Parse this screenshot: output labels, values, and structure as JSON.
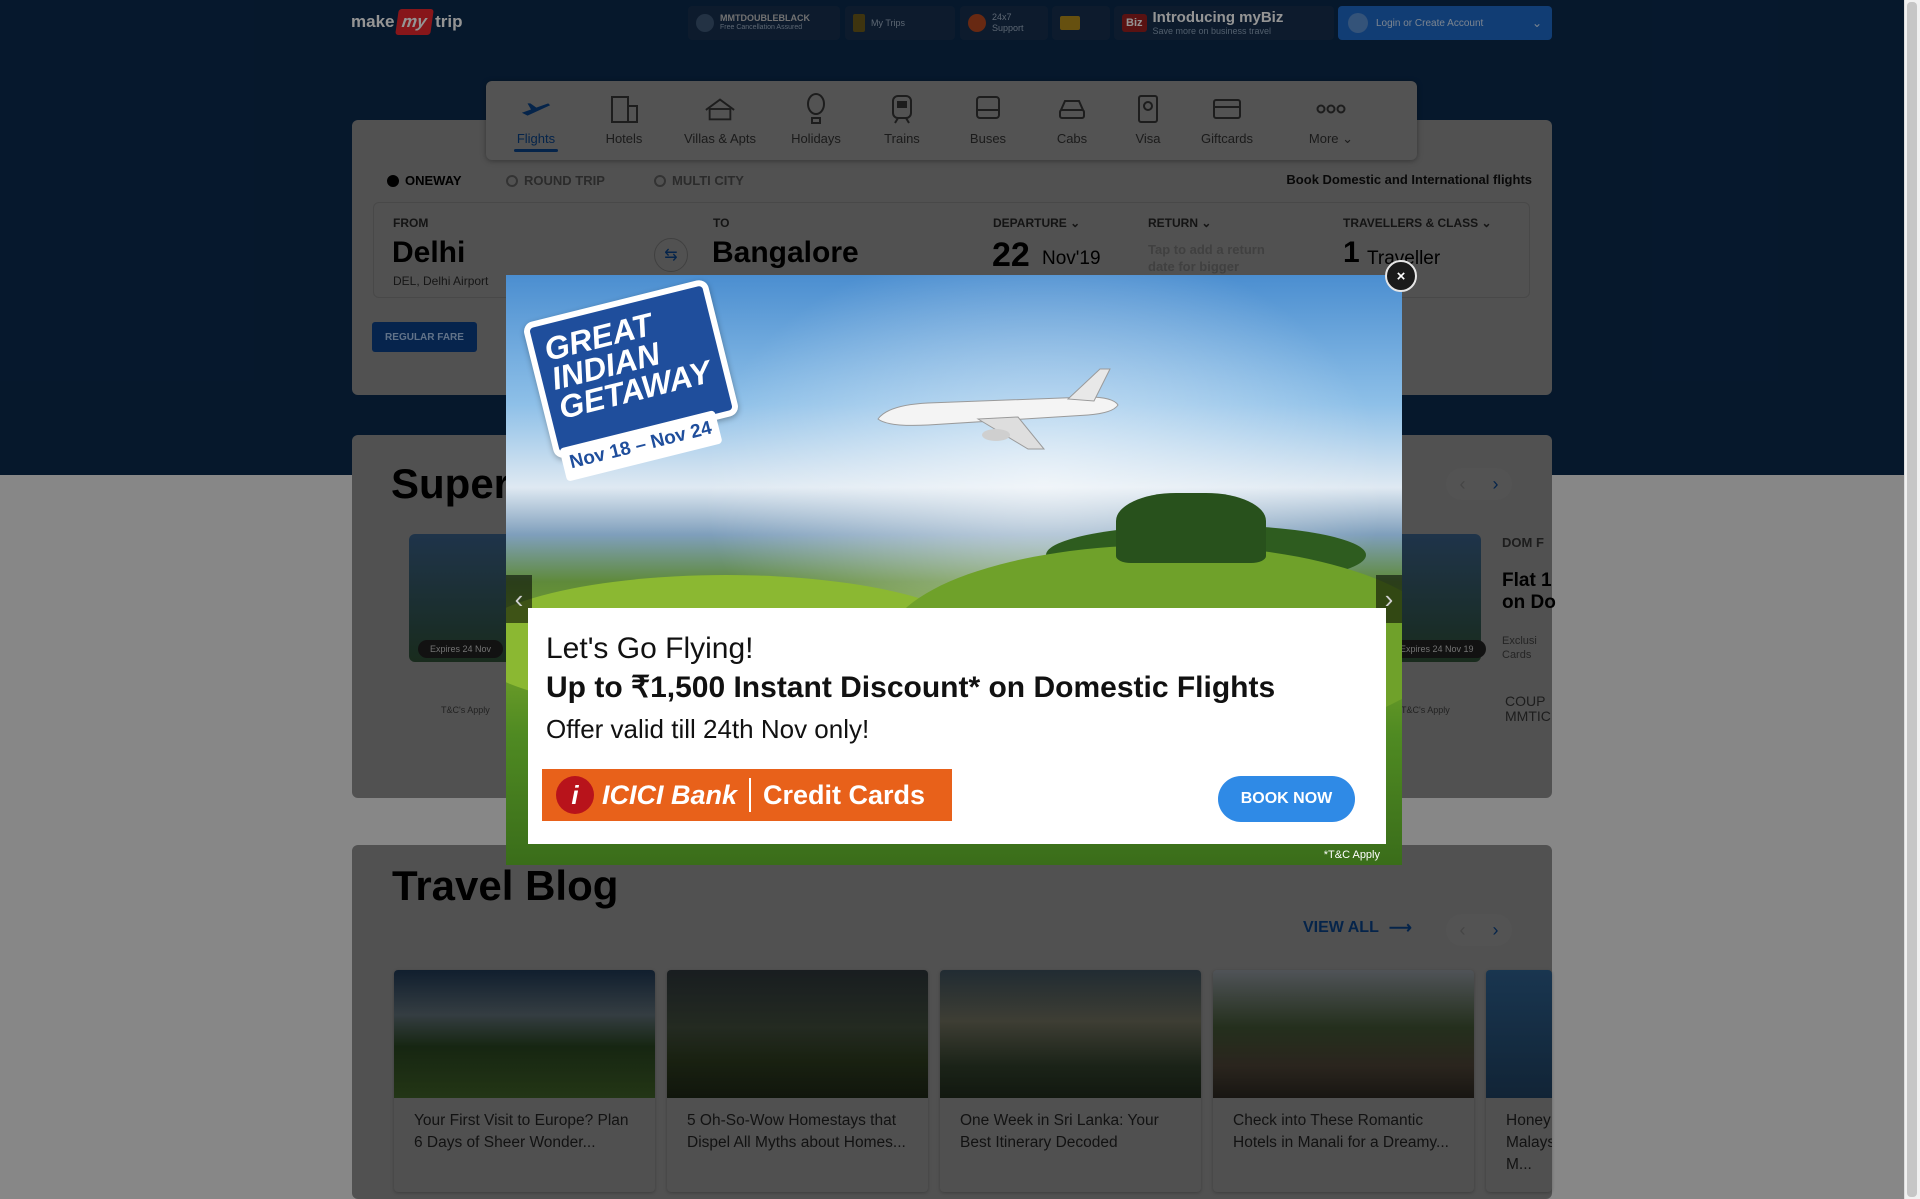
{
  "header": {
    "logo_make": "make",
    "logo_my": "my",
    "logo_trip": "trip",
    "doubleblack_title": "MMTDOUBLEBLACK",
    "doubleblack_sub": "Free Cancellation Assured",
    "mytrips": "My Trips",
    "support_title": "24x7",
    "support_sub": "Support",
    "biz_label": "Biz",
    "biz_title": "Introducing myBiz",
    "biz_sub": "Save more on business travel",
    "login": "Login or Create Account"
  },
  "nav": [
    {
      "label": "Flights",
      "icon": "flight-icon"
    },
    {
      "label": "Hotels",
      "icon": "hotel-icon"
    },
    {
      "label": "Villas & Apts",
      "icon": "villa-icon"
    },
    {
      "label": "Holidays",
      "icon": "balloon-icon"
    },
    {
      "label": "Trains",
      "icon": "train-icon"
    },
    {
      "label": "Buses",
      "icon": "bus-icon"
    },
    {
      "label": "Cabs",
      "icon": "cab-icon"
    },
    {
      "label": "Visa",
      "icon": "visa-icon"
    },
    {
      "label": "Giftcards",
      "icon": "giftcard-icon"
    },
    {
      "label": "More",
      "icon": "more-icon"
    }
  ],
  "search": {
    "trip_types": [
      "ONEWAY",
      "ROUND TRIP",
      "MULTI CITY"
    ],
    "book_text": "Book Domestic and International flights",
    "from_label": "FROM",
    "from_city": "Delhi",
    "from_sub": "DEL, Delhi Airport",
    "to_label": "TO",
    "to_city": "Bangalore",
    "departure_label": "DEPARTURE",
    "departure_day": "22",
    "departure_month": "Nov'19",
    "return_label": "RETURN",
    "return_hint": "Tap to add a return date for bigger",
    "travellers_label": "TRAVELLERS & CLASS",
    "travellers_count": "1",
    "travellers_text": "Traveller",
    "fare_button": "REGULAR FARE"
  },
  "offers": {
    "title_partial": "Super",
    "expires": "Expires 24 Nov",
    "expires_right": "Expires 24 Nov 19",
    "tc": "T&C's Apply",
    "dom_tag": "DOM F",
    "flat_line1": "Flat 1",
    "flat_line2": "on Do",
    "excl_line1": "Exclusi",
    "excl_line2": "Cards",
    "coupon_line1": "COUP",
    "coupon_line2": "MMTIC"
  },
  "blog": {
    "title": "Travel Blog",
    "view_all": "VIEW ALL",
    "items": [
      {
        "text": "Your First Visit to Europe? Plan 6 Days of Sheer Wonder..."
      },
      {
        "text": "5 Oh-So-Wow Homestays that Dispel All Myths about Homes..."
      },
      {
        "text": "One Week in Sri Lanka: Your Best Itinerary Decoded"
      },
      {
        "text": "Check into These Romantic Hotels in Manali for a Dreamy..."
      },
      {
        "text": "Honey Malays M..."
      }
    ]
  },
  "modal": {
    "badge_title": "GREAT INDIAN GETAWAY",
    "badge_dates": "Nov 18 – Nov 24",
    "line1": "Let's Go Flying!",
    "line2": "Up to ₹1,500 Instant Discount* on Domestic Flights",
    "line3": "Offer valid till 24th Nov only!",
    "bank_logo_letter": "i",
    "bank_name": "ICICI Bank",
    "bank_product": "Credit Cards",
    "book_now": "BOOK NOW",
    "tc": "*T&C Apply",
    "close": "×"
  },
  "colors": {
    "brand_blue": "#0a3f80",
    "header_bg": "#0b2a4d",
    "book_btn": "#2f8ae6",
    "icici_orange": "#e8611a",
    "logo_red": "#e8262d"
  }
}
